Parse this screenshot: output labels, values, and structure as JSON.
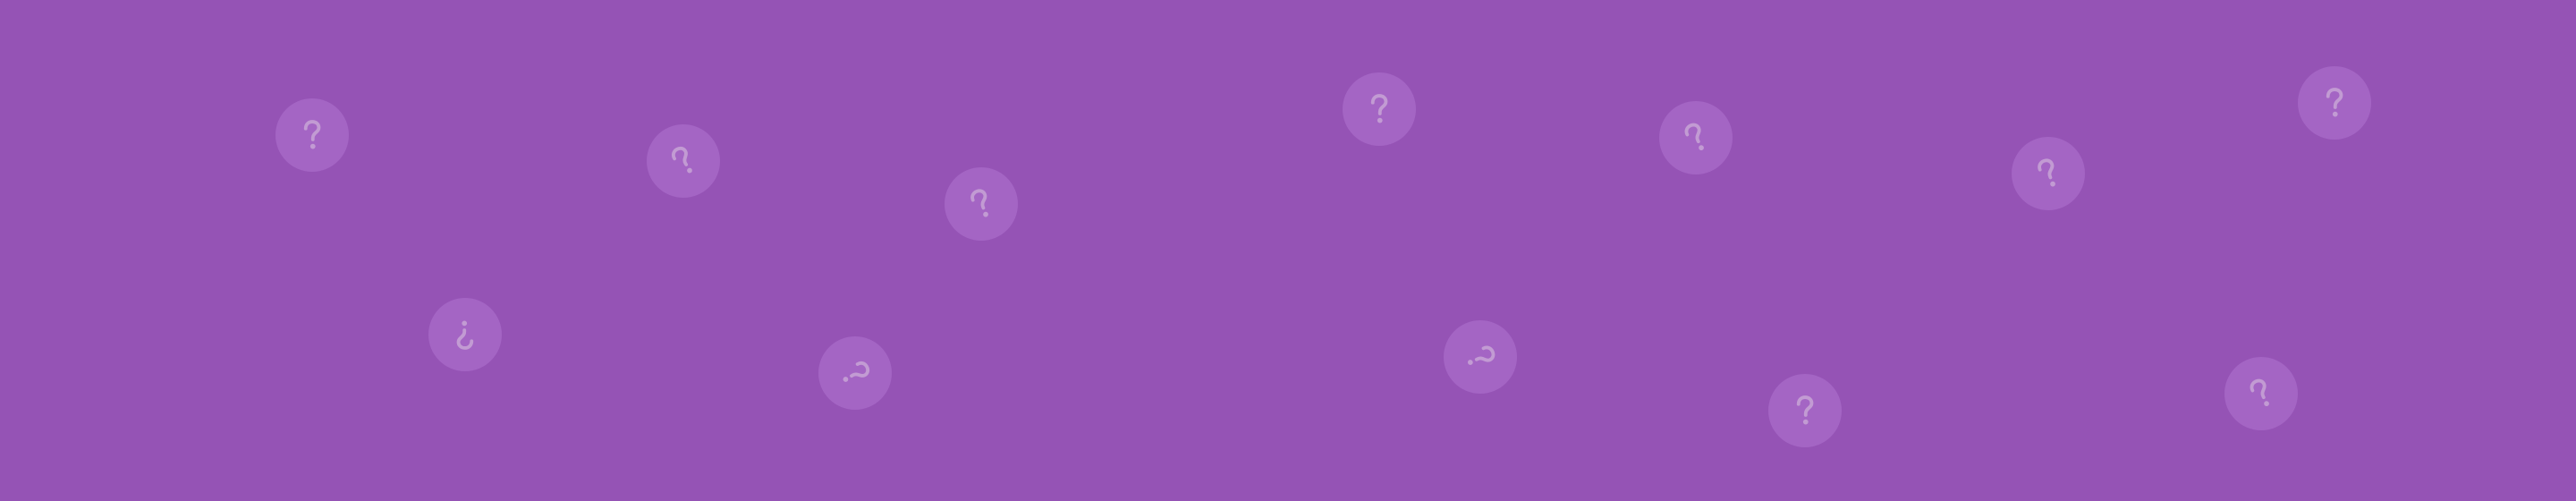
{
  "banner": {
    "background": "#9553b5",
    "bubble_color": "#a465c4",
    "glyph_color": "#c29bd3",
    "icon": "question-mark-icon",
    "bubbles": [
      {
        "rotation": 0
      },
      {
        "rotation": -30
      },
      {
        "rotation": -20
      },
      {
        "rotation": 180
      },
      {
        "rotation": 60
      },
      {
        "rotation": 0
      },
      {
        "rotation": 65
      },
      {
        "rotation": -25
      },
      {
        "rotation": 0
      },
      {
        "rotation": -20
      },
      {
        "rotation": -25
      },
      {
        "rotation": 0
      }
    ]
  }
}
